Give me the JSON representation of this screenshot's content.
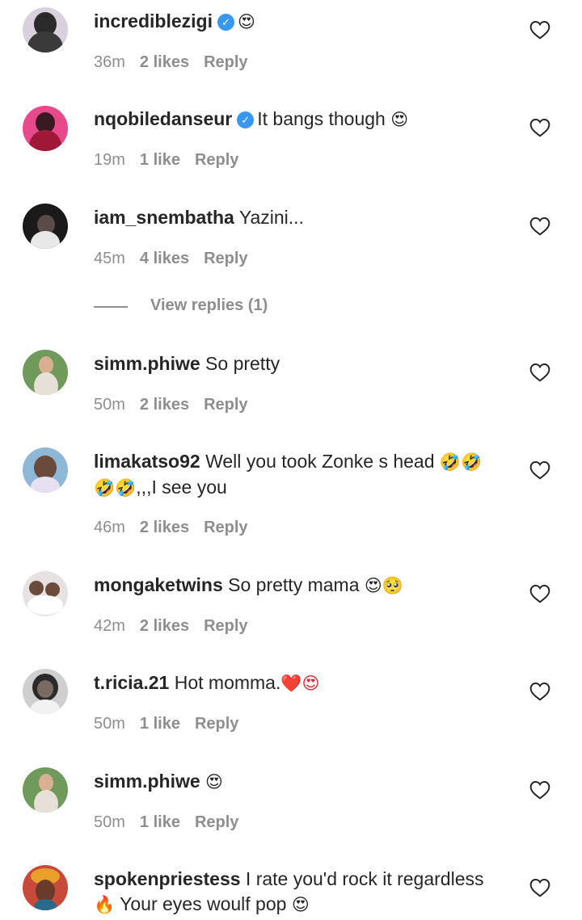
{
  "comments": [
    {
      "username": "incrediblezigi",
      "verified": true,
      "text": "",
      "emoji": "😍",
      "time": "36m",
      "likes": "2 likes",
      "reply": "Reply",
      "avatar_color": "#d8d0dc"
    },
    {
      "username": "nqobiledanseur",
      "verified": true,
      "text": "It bangs though",
      "emoji": "😍",
      "time": "19m",
      "likes": "1 like",
      "reply": "Reply",
      "avatar_color": "#e64a8a"
    },
    {
      "username": "iam_snembatha",
      "verified": false,
      "text": "Yazini...",
      "emoji": "",
      "time": "45m",
      "likes": "4 likes",
      "reply": "Reply",
      "avatar_color": "#1a1a1a"
    },
    {
      "username": "simm.phiwe",
      "verified": false,
      "text": "So pretty",
      "emoji": "",
      "time": "50m",
      "likes": "2 likes",
      "reply": "Reply",
      "avatar_color": "#6f9a5c"
    },
    {
      "username": "limakatso92",
      "verified": false,
      "text": "Well you took Zonke s head",
      "emoji": "🤣🤣",
      "line2_emoji": "🤣🤣",
      "line2_text": ",,,I see you",
      "time": "46m",
      "likes": "2 likes",
      "reply": "Reply",
      "avatar_color": "#8fb8d8"
    },
    {
      "username": "mongaketwins",
      "verified": false,
      "text": "So pretty mama",
      "emoji": "😍🥺",
      "time": "42m",
      "likes": "2 likes",
      "reply": "Reply",
      "avatar_color": "#e6e2e2"
    },
    {
      "username": "t.ricia.21",
      "verified": false,
      "text": "Hot momma.",
      "emoji": "❤️😍",
      "time": "50m",
      "likes": "1 like",
      "reply": "Reply",
      "avatar_color": "#cfcfcf"
    },
    {
      "username": "simm.phiwe",
      "verified": false,
      "text": "",
      "emoji": "😍",
      "time": "50m",
      "likes": "1 like",
      "reply": "Reply",
      "avatar_color": "#6f9a5c"
    },
    {
      "username": "spokenpriestess",
      "verified": false,
      "text": "I rate you'd rock it regardless",
      "emoji": "",
      "line2_emoji": "🔥",
      "line2_text": "Your eyes woulf pop",
      "line2_emoji_end": "😍",
      "avatar_color": "#c84a3a"
    }
  ],
  "view_replies": "View replies (1)",
  "icons": {
    "heart": "heart-outline-icon",
    "verified": "verified-badge-icon"
  },
  "colors": {
    "text": "#262626",
    "meta": "#8e8e8e",
    "verified": "#3897f0",
    "emoji_face": "#f4c028",
    "emoji_heart": "#e8232e"
  }
}
